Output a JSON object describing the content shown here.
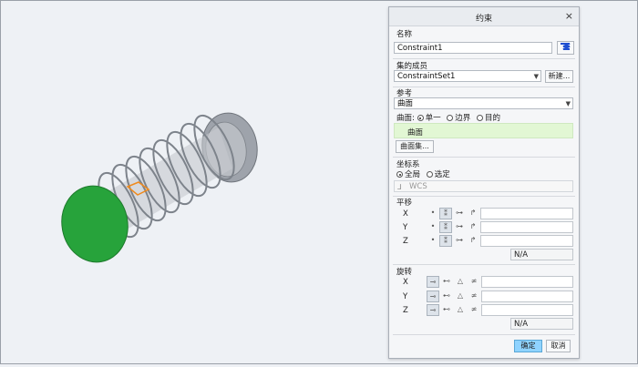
{
  "colors": {
    "accent": "#8fd3ff",
    "highlight": "#e2f7d4",
    "end_cap": "#27a33b"
  },
  "dialog": {
    "title": "约束",
    "close": "×",
    "name": {
      "label": "名称",
      "value": "Constraint1"
    },
    "set_member": {
      "label": "集的成员",
      "value": "ConstraintSet1",
      "new_button": "新建..."
    },
    "reference": {
      "label": "参考",
      "type": "曲面",
      "selector_label": "曲面:",
      "options": [
        "单一",
        "边界",
        "目的"
      ],
      "selected_item": "曲面",
      "surface_set_button": "曲面集..."
    },
    "coord": {
      "label": "坐标系",
      "options": [
        "全局",
        "选定"
      ],
      "csys": "WCS"
    },
    "translation": {
      "label": "平移",
      "axes": [
        "X",
        "Y",
        "Z"
      ],
      "na": "N/A"
    },
    "rotation": {
      "label": "旋转",
      "axes": [
        "X",
        "Y",
        "Z"
      ],
      "na": "N/A"
    },
    "ok": "确定",
    "cancel": "取消"
  }
}
